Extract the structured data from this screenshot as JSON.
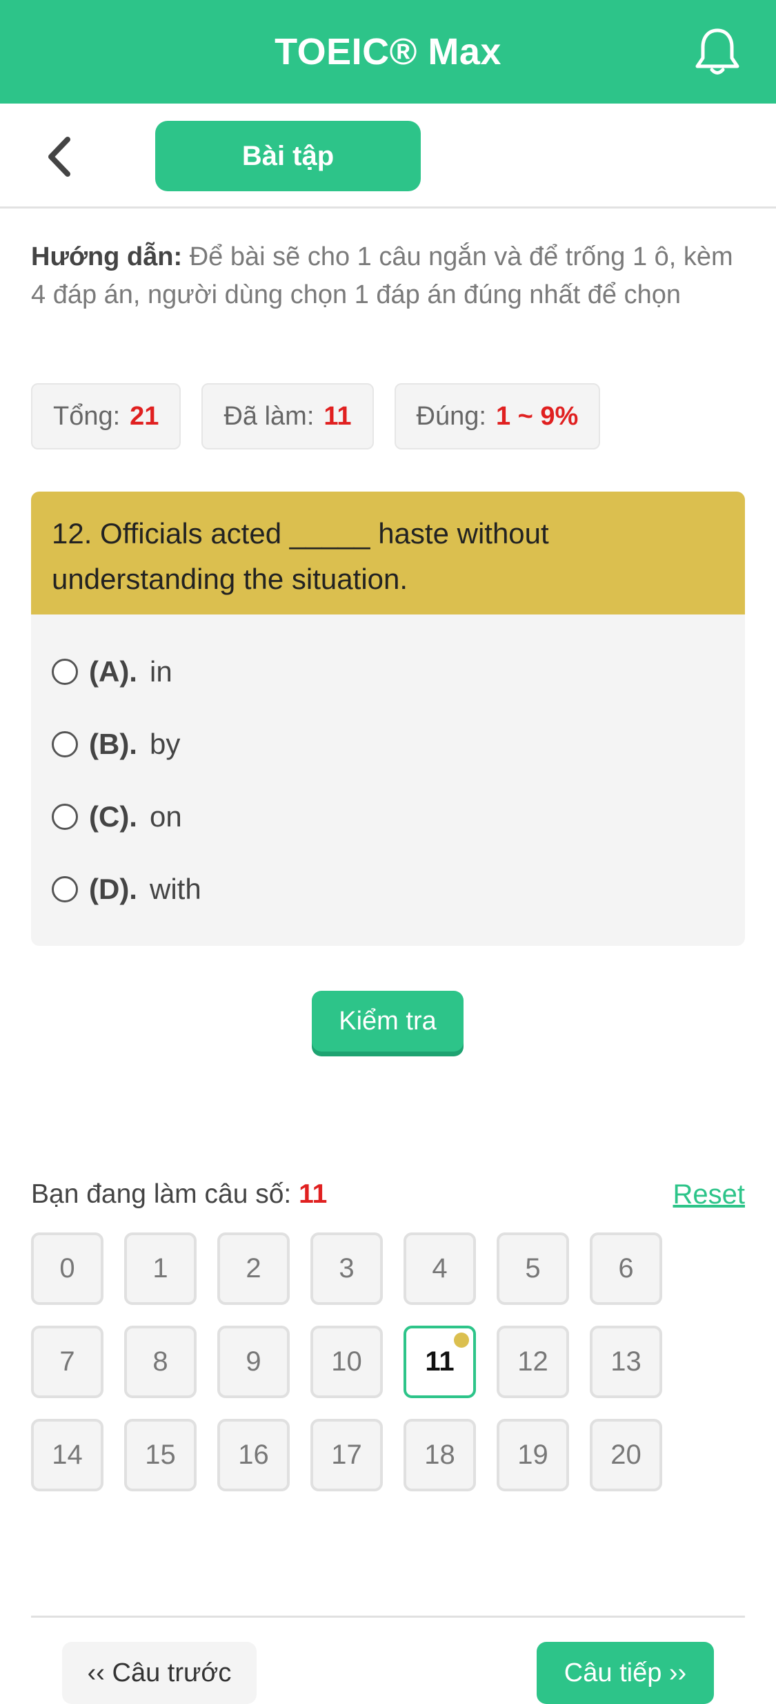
{
  "header": {
    "title": "TOEIC® Max",
    "bell_icon": "bell-icon",
    "color": "#2dc489"
  },
  "subbar": {
    "back_icon": "chevron-left-icon",
    "tab_label": "Bài tập"
  },
  "instructions": {
    "label": "Hướng dẫn:",
    "text": " Để bài sẽ cho 1 câu ngắn và để trống 1 ô, kèm 4 đáp án, người dùng chọn 1 đáp án đúng nhất để chọn"
  },
  "stats": {
    "total_label": "Tổng:",
    "total_value": "21",
    "done_label": "Đã làm:",
    "done_value": "11",
    "correct_label": "Đúng:",
    "correct_value": "1 ~ 9%"
  },
  "question": {
    "text": "12. Officials acted _____ haste without understanding the situation.",
    "options": [
      {
        "key": "(A).",
        "text": "in"
      },
      {
        "key": "(B).",
        "text": "by"
      },
      {
        "key": "(C).",
        "text": "on"
      },
      {
        "key": "(D).",
        "text": "with"
      }
    ]
  },
  "check_button": "Kiểm tra",
  "progress": {
    "label": "Bạn đang làm câu số:",
    "current": "11",
    "reset": "Reset"
  },
  "question_numbers": [
    "0",
    "1",
    "2",
    "3",
    "4",
    "5",
    "6",
    "7",
    "8",
    "9",
    "10",
    "11",
    "12",
    "13",
    "14",
    "15",
    "16",
    "17",
    "18",
    "19",
    "20"
  ],
  "active_question": "11",
  "nav": {
    "prev": "‹‹ Câu trước",
    "next": "Câu tiếp ››"
  }
}
